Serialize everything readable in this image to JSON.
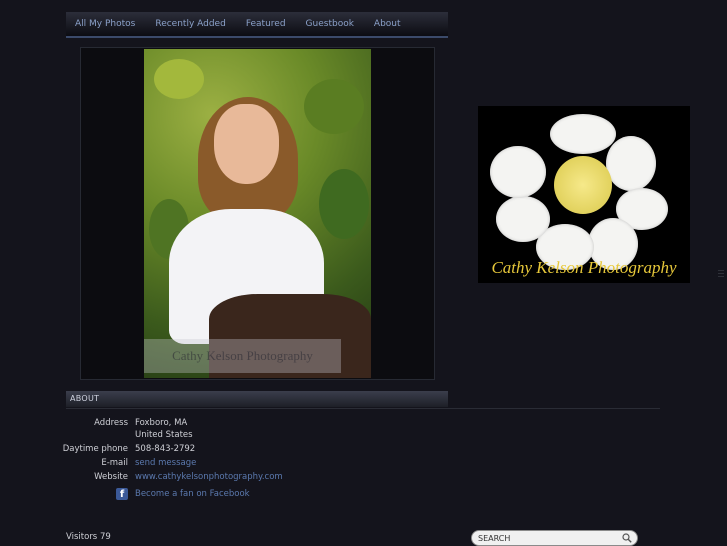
{
  "nav": {
    "items": [
      "All My Photos",
      "Recently Added",
      "Featured",
      "Guestbook",
      "About"
    ]
  },
  "photo": {
    "watermark": "Cathy Kelson Photography"
  },
  "logo": {
    "text": "Cathy Kelson Photography"
  },
  "about": {
    "heading": "ABOUT",
    "address_label": "Address",
    "address_line1": "Foxboro, MA",
    "address_line2": "United States",
    "phone_label": "Daytime phone",
    "phone": "508-843-2792",
    "email_label": "E-mail",
    "email_link": "send message",
    "website_label": "Website",
    "website": "www.cathykelsonphotography.com",
    "facebook_link": "Become a fan on Facebook"
  },
  "footer": {
    "visitors_label": "Visitors",
    "visitors_count": "79"
  },
  "search": {
    "placeholder": "SEARCH"
  },
  "colors": {
    "background": "#14141c",
    "nav_text": "#8aa0c8",
    "link": "#5b79ae",
    "logo_text": "#e7c83a"
  }
}
